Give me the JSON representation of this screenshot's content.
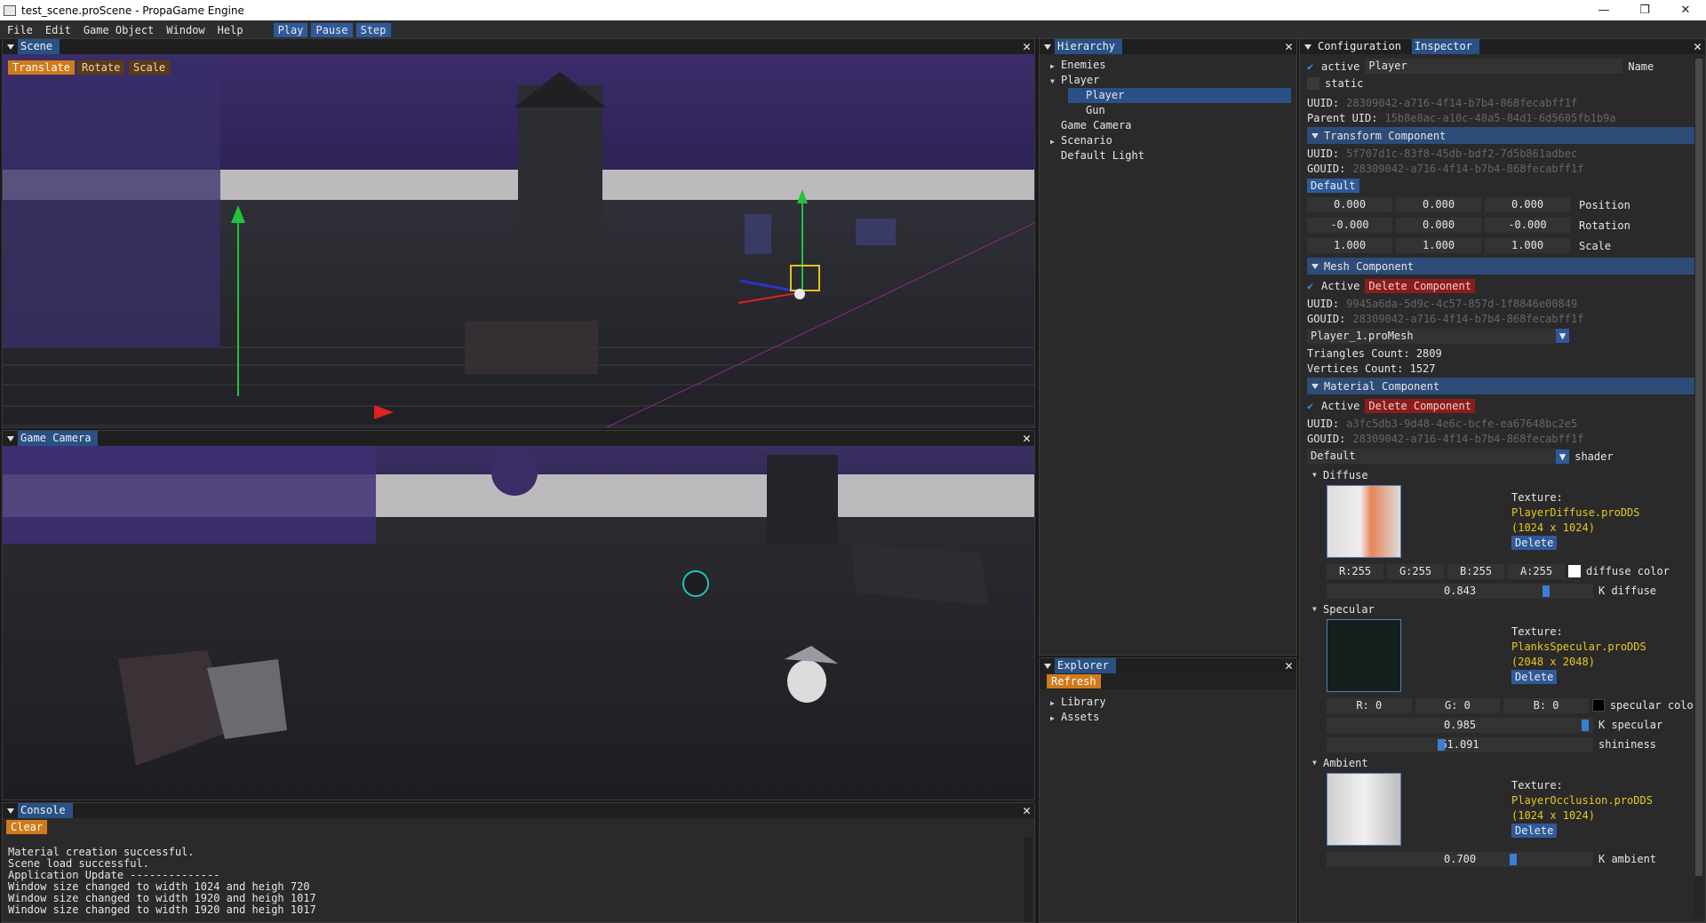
{
  "window": {
    "title": "test_scene.proScene - PropaGame Engine",
    "controls": [
      "—",
      "❐",
      "✕"
    ]
  },
  "menubar": {
    "items": [
      "File",
      "Edit",
      "Game Object",
      "Window",
      "Help"
    ],
    "play": "Play",
    "pause": "Pause",
    "step": "Step"
  },
  "scene": {
    "title": "Scene",
    "tools": [
      "Translate",
      "Rotate",
      "Scale"
    ],
    "active_tool": "Translate"
  },
  "game_camera": {
    "title": "Game Camera"
  },
  "console": {
    "title": "Console",
    "clear": "Clear",
    "lines": [
      "Material creation successful.",
      "Scene load successful.",
      "Application Update --------------",
      "Window size changed to width 1024 and heigh 720",
      "Window size changed to width 1920 and heigh 1017",
      "Window size changed to width 1920 and heigh 1017"
    ]
  },
  "hierarchy": {
    "title": "Hierarchy",
    "nodes": [
      {
        "label": "Enemies",
        "expander": "▶",
        "indent": 0
      },
      {
        "label": "Player",
        "expander": "▼",
        "indent": 0
      },
      {
        "label": "Player",
        "expander": "",
        "indent": 1,
        "selected": true
      },
      {
        "label": "Gun",
        "expander": "",
        "indent": 1
      },
      {
        "label": "Game Camera",
        "expander": "",
        "indent": 0
      },
      {
        "label": "Scenario",
        "expander": "▶",
        "indent": 0
      },
      {
        "label": "Default Light",
        "expander": "",
        "indent": 0
      }
    ]
  },
  "explorer": {
    "title": "Explorer",
    "refresh": "Refresh",
    "nodes": [
      {
        "label": "Library",
        "expander": "▶"
      },
      {
        "label": "Assets",
        "expander": "▶"
      }
    ]
  },
  "inspector": {
    "tab_config": "Configuration",
    "tab_inspector": "Inspector",
    "active_label": "active",
    "name_value": "Player",
    "name_label": "Name",
    "static_label": "static",
    "uuid_label": "UUID:",
    "uuid": "28309042-a716-4f14-b7b4-868fecabff1f",
    "parent_uid_label": "Parent UID:",
    "parent_uid": "15b8e8ac-a10c-48a5-84d1-6d5605fb1b9a",
    "transform": {
      "header": "Transform Component",
      "uuid": "5f707d1c-83f8-45db-bdf2-7d5b861adbec",
      "gouid_label": "GOUID:",
      "gouid": "28309042-a716-4f14-b7b4-868fecabff1f",
      "default_btn": "Default",
      "position": [
        "0.000",
        "0.000",
        "0.000"
      ],
      "position_label": "Position",
      "rotation": [
        "-0.000",
        "0.000",
        "-0.000"
      ],
      "rotation_label": "Rotation",
      "scale": [
        "1.000",
        "1.000",
        "1.000"
      ],
      "scale_label": "Scale"
    },
    "mesh": {
      "header": "Mesh Component",
      "active": "Active",
      "delete": "Delete Component",
      "uuid": "9945a6da-5d9c-4c57-857d-1f8846e00849",
      "gouid": "28309042-a716-4f14-b7b4-868fecabff1f",
      "mesh_file": "Player_1.proMesh",
      "triangles": "Triangles Count: 2809",
      "vertices": "Vertices Count: 1527"
    },
    "material": {
      "header": "Material Component",
      "active": "Active",
      "delete": "Delete Component",
      "uuid": "a3fc5db3-9d48-4e6c-bcfe-ea67648bc2e5",
      "gouid": "28309042-a716-4f14-b7b4-868fecabff1f",
      "shader_value": "Default",
      "shader_label": "shader",
      "texture_label": "Texture:",
      "delete_btn": "Delete",
      "diffuse": {
        "header": "Diffuse",
        "file": "PlayerDiffuse.proDDS",
        "size": "(1024 x 1024)",
        "rgba": [
          "R:255",
          "G:255",
          "B:255",
          "A:255"
        ],
        "color_label": "diffuse color",
        "color": "#ffffff",
        "k_value": "0.843",
        "k_fraction": 0.843,
        "k_label": "K diffuse"
      },
      "specular": {
        "header": "Specular",
        "file": "PlanksSpecular.proDDS",
        "size": "(2048 x 2048)",
        "rgb": [
          "R:  0",
          "G:  0",
          "B:  0"
        ],
        "color_label": "specular color",
        "color": "#000000",
        "k_value": "0.985",
        "k_fraction": 0.985,
        "k_label": "K specular",
        "shininess_value": "61.091",
        "shininess_fraction": 0.42,
        "shininess_label": "shininess"
      },
      "ambient": {
        "header": "Ambient",
        "file": "PlayerOcclusion.proDDS",
        "size": "(1024 x 1024)",
        "k_value": "0.700",
        "k_fraction": 0.7,
        "k_label": "K ambient"
      }
    }
  },
  "colors": {
    "accent": "#2a5186",
    "tool_active": "#d07a1a",
    "danger": "#8c1c1c",
    "texture_text": "#e6c820"
  }
}
